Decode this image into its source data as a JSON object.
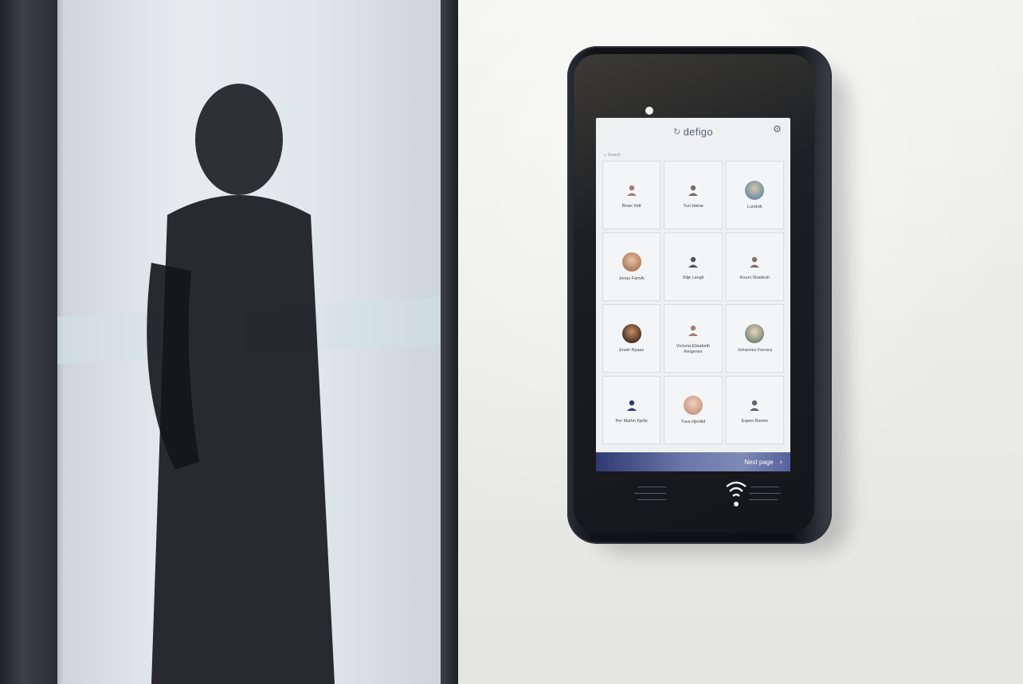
{
  "device": {
    "brand": "defigo",
    "search_label": "Search",
    "residents": [
      {
        "name": "Brian Vett",
        "avatar": "generic"
      },
      {
        "name": "Turi Halvø",
        "avatar": "generic"
      },
      {
        "name": "Lundvik",
        "avatar": "photo"
      },
      {
        "name": "Jonas Fanvik",
        "avatar": "photo"
      },
      {
        "name": "Silje Langli",
        "avatar": "generic"
      },
      {
        "name": "Ruuni Shadesh",
        "avatar": "generic"
      },
      {
        "name": "Erwin Ryaas",
        "avatar": "photo"
      },
      {
        "name": "Victoria Elisabeth Reigenes",
        "avatar": "generic"
      },
      {
        "name": "Johannes Ferrera",
        "avatar": "photo"
      },
      {
        "name": "Per Martin Kjelle",
        "avatar": "generic-dark"
      },
      {
        "name": "Tuva Hjertild",
        "avatar": "photo"
      },
      {
        "name": "Espen Barton",
        "avatar": "generic"
      }
    ],
    "next_page_label": "Next page",
    "icons": {
      "settings": "gear-icon",
      "search": "search-icon",
      "next": "chevron-right-icon",
      "nfc": "wireless-icon"
    },
    "colors": {
      "accent": "#3a4680",
      "screen_bg": "#eef0f2"
    }
  }
}
